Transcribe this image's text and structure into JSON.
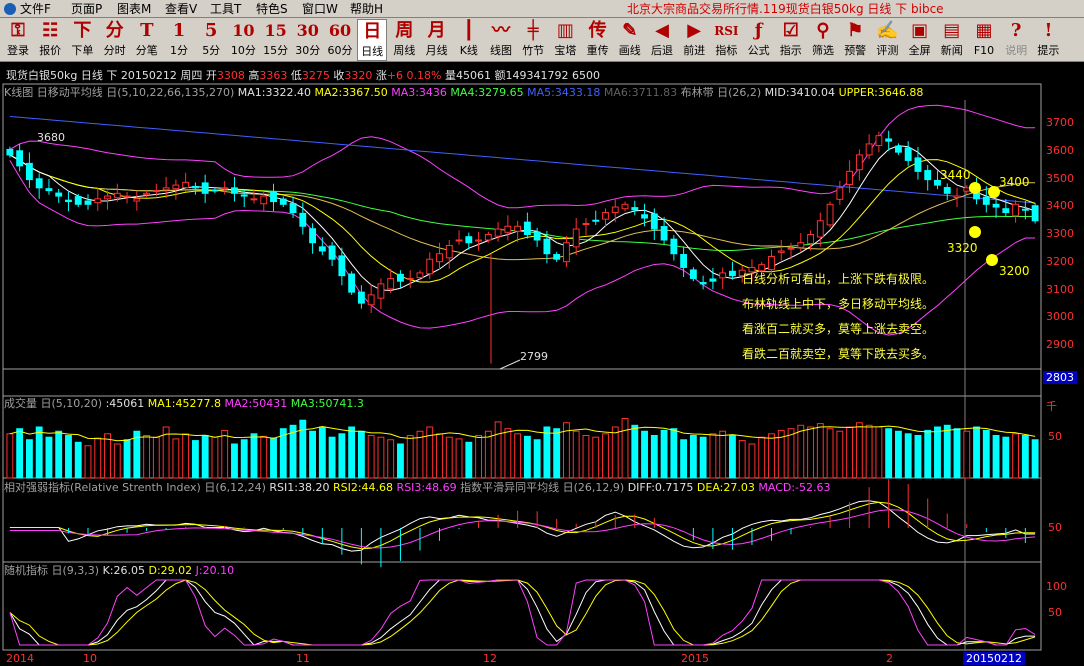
{
  "menu": {
    "items": [
      "文件F",
      "页面P",
      "图表M",
      "查看V",
      "工具T",
      "特色S",
      "窗口W",
      "帮助H"
    ],
    "title": "北京大宗商品交易所行情.119现货白银50kg 日线 下 bibce"
  },
  "toolbar": {
    "buttons": [
      {
        "label": "登录",
        "icon": "login-icon",
        "glyph": "⚿"
      },
      {
        "label": "报价",
        "icon": "quote-icon",
        "glyph": "☷"
      },
      {
        "label": "下单",
        "icon": "order-icon",
        "glyph": "下"
      },
      {
        "label": "分时",
        "icon": "minute-icon",
        "glyph": "分"
      },
      {
        "label": "分笔",
        "icon": "tick-icon",
        "glyph": "T"
      },
      {
        "label": "1分",
        "icon": "1min-icon",
        "glyph": "1"
      },
      {
        "label": "5分",
        "icon": "5min-icon",
        "glyph": "5"
      },
      {
        "label": "10分",
        "icon": "10min-icon",
        "glyph": "10"
      },
      {
        "label": "15分",
        "icon": "15min-icon",
        "glyph": "15"
      },
      {
        "label": "30分",
        "icon": "30min-icon",
        "glyph": "30"
      },
      {
        "label": "60分",
        "icon": "60min-icon",
        "glyph": "60"
      },
      {
        "label": "日线",
        "icon": "day-icon",
        "glyph": "日"
      },
      {
        "label": "周线",
        "icon": "week-icon",
        "glyph": "周"
      },
      {
        "label": "月线",
        "icon": "month-icon",
        "glyph": "月"
      },
      {
        "label": "K线",
        "icon": "kline-icon",
        "glyph": "┃"
      },
      {
        "label": "线图",
        "icon": "linechart-icon",
        "glyph": "〰"
      },
      {
        "label": "竹节",
        "icon": "bamboo-icon",
        "glyph": "╪"
      },
      {
        "label": "宝塔",
        "icon": "tower-icon",
        "glyph": "▥"
      },
      {
        "label": "重传",
        "icon": "reload-icon",
        "glyph": "传"
      },
      {
        "label": "画线",
        "icon": "pen-icon",
        "glyph": "✎"
      },
      {
        "label": "后退",
        "icon": "back-icon",
        "glyph": "◀"
      },
      {
        "label": "前进",
        "icon": "forward-icon",
        "glyph": "▶"
      },
      {
        "label": "指标",
        "icon": "rsi-icon",
        "glyph": "RSI"
      },
      {
        "label": "公式",
        "icon": "formula-icon",
        "glyph": "ƒ"
      },
      {
        "label": "指示",
        "icon": "indicate-icon",
        "glyph": "☑"
      },
      {
        "label": "筛选",
        "icon": "filter-icon",
        "glyph": "⚲"
      },
      {
        "label": "预警",
        "icon": "alert-icon",
        "glyph": "⚑"
      },
      {
        "label": "评测",
        "icon": "evaluate-icon",
        "glyph": "✍"
      },
      {
        "label": "全屏",
        "icon": "fullscreen-icon",
        "glyph": "▣"
      },
      {
        "label": "新闻",
        "icon": "news-icon",
        "glyph": "▤"
      },
      {
        "label": "F10",
        "icon": "f10-icon",
        "glyph": "▦"
      },
      {
        "label": "说明",
        "icon": "help-icon",
        "glyph": "?"
      },
      {
        "label": "提示",
        "icon": "tip-icon",
        "glyph": "!"
      }
    ],
    "selected": "日线",
    "disabled": [
      "说明"
    ]
  },
  "infobar": {
    "name": "现货白银50kg 日线 下 20150212 周四",
    "open_label": "开",
    "open": "3308",
    "high_label": "高",
    "high": "3363",
    "low_label": "低",
    "low": "3275",
    "close_label": "收",
    "close": "3320",
    "change_label": "涨",
    "change": "+6 0.18%",
    "volume_label": "量",
    "volume": "45061",
    "amount_label": "额",
    "amount": "149341792 6500"
  },
  "kline_legend": {
    "prefix": "K线图 日移动平均线 日(5,10,22,66,135,270)",
    "ma1": "MA1:3322.40",
    "ma2": "MA2:3367.50",
    "ma3": "MA3:3436",
    "ma4": "MA4:3279.65",
    "ma5": "MA5:3433.18",
    "ma6": "MA6:3711.83",
    "boll": "布林带 日(26,2)",
    "mid": "MID:3410.04",
    "upper": "UPPER:3646.88"
  },
  "vol_legend": {
    "prefix": "成交量 日(5,10,20)",
    "vol": ":45061",
    "ma1": "MA1:45277.8",
    "ma2": "MA2:50431",
    "ma3": "MA3:50741.3"
  },
  "rsi_legend": {
    "prefix": "相对强弱指标(Relative Strenth Index) 日(6,12,24)",
    "rsi1": "RSI1:38.20",
    "rsi2": "RSI2:44.68",
    "rsi3": "RSI3:48.69",
    "macd_prefix": "指数平滑异同平均线 日(26,12,9)",
    "diff": "DIFF:0.7175",
    "dea": "DEA:27.03",
    "macd": "MACD:-52.63"
  },
  "kdj_legend": {
    "prefix": "随机指标 日(9,3,3)",
    "k": "K:26.05",
    "d": "D:29.02",
    "j": "J:20.10"
  },
  "price_axis": [
    "3700",
    "3600",
    "3500",
    "3400",
    "3300",
    "3200",
    "3100",
    "3000",
    "2900"
  ],
  "price_current": "2803",
  "vol_axis": {
    "unit": "千",
    "tick": "50"
  },
  "rsi_axis": "50",
  "kdj_axis": [
    "100",
    "50"
  ],
  "date_axis": [
    "2014",
    "10",
    "11",
    "12",
    "2015",
    "2"
  ],
  "date_current": "20150212",
  "annotations": {
    "high": "3680",
    "low": "2799",
    "r1": "3440",
    "r2": "3400",
    "s1": "3320",
    "s2": "3200",
    "notes": [
      "日线分析可看出，上涨下跌有极限。",
      "布林轨线上中下，多日移动平均线。",
      "看涨百二就买多，莫等上涨去卖空。",
      "看跌二百就卖空，莫等下跌去买多。"
    ]
  },
  "colors": {
    "up": "#ff3030",
    "down": "#00ffff",
    "ma1": "#ffffff",
    "ma2": "#ffff00",
    "ma3": "#ff40ff",
    "ma4": "#40ff40",
    "ma5": "#4060ff",
    "boll": "#ff40ff",
    "highlight": "#ffff00"
  },
  "chart_data": {
    "type": "candlestick",
    "ylim": [
      2780,
      3760
    ],
    "close": [
      3560,
      3520,
      3470,
      3440,
      3430,
      3410,
      3390,
      3380,
      3380,
      3400,
      3410,
      3420,
      3410,
      3400,
      3420,
      3430,
      3440,
      3450,
      3460,
      3440,
      3420,
      3430,
      3440,
      3420,
      3410,
      3400,
      3410,
      3390,
      3380,
      3350,
      3300,
      3240,
      3210,
      3180,
      3120,
      3060,
      3020,
      3050,
      3090,
      3110,
      3100,
      3110,
      3130,
      3180,
      3200,
      3230,
      3250,
      3240,
      3250,
      3270,
      3290,
      3300,
      3300,
      3270,
      3250,
      3200,
      3180,
      3240,
      3290,
      3310,
      3320,
      3350,
      3370,
      3380,
      3360,
      3330,
      3290,
      3250,
      3200,
      3150,
      3110,
      3090,
      3100,
      3130,
      3120,
      3140,
      3150,
      3160,
      3190,
      3210,
      3220,
      3240,
      3270,
      3320,
      3380,
      3440,
      3500,
      3560,
      3600,
      3630,
      3610,
      3570,
      3540,
      3500,
      3470,
      3450,
      3420,
      3410,
      3440,
      3400,
      3380,
      3370,
      3350,
      3380,
      3360,
      3320
    ],
    "volume": [
      52,
      58,
      45,
      60,
      48,
      55,
      50,
      42,
      38,
      47,
      52,
      40,
      45,
      55,
      50,
      48,
      60,
      46,
      52,
      44,
      50,
      48,
      56,
      40,
      45,
      52,
      49,
      47,
      58,
      62,
      68,
      55,
      60,
      48,
      52,
      60,
      55,
      50,
      48,
      45,
      40,
      50,
      55,
      60,
      52,
      48,
      46,
      42,
      50,
      55,
      66,
      58,
      52,
      49,
      45,
      60,
      58,
      65,
      55,
      50,
      48,
      52,
      60,
      70,
      62,
      55,
      50,
      56,
      58,
      45,
      50,
      48,
      52,
      55,
      50,
      44,
      40,
      48,
      52,
      56,
      58,
      62,
      60,
      64,
      58,
      55,
      60,
      65,
      62,
      60,
      58,
      55,
      52,
      50,
      56,
      60,
      62,
      58,
      55,
      60,
      56,
      50,
      48,
      52,
      50,
      45
    ]
  }
}
